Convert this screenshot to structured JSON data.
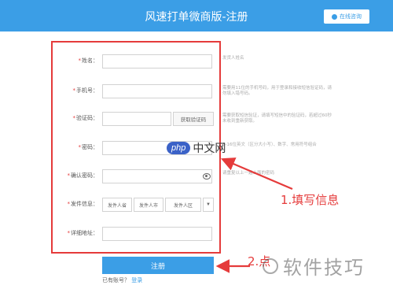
{
  "header": {
    "title": "风速打单微商版-注册",
    "consult_label": "在线咨询"
  },
  "fields": [
    {
      "label": "姓名：",
      "hint": "发货人姓名"
    },
    {
      "label": "手机号：",
      "hint": "需要用11位的手机号码，用于登录和接收短信验证码，请勿填入错号码。"
    },
    {
      "label": "验证码：",
      "hint": "需要获取短信验证，请填写短信中的验证码，若超过60秒未收到重新获取。",
      "button": "获取验证码"
    },
    {
      "label": "密码：",
      "hint": "6-16位英文（区分大小写）、数字、常用符号组合"
    },
    {
      "label": "确认密码：",
      "hint": "请重复以上一遍上面的密码"
    },
    {
      "label": "发件信息：",
      "selects": [
        "发件人省",
        "发件人市",
        "发件人区"
      ]
    },
    {
      "label": "详细地址：",
      "hint": ""
    }
  ],
  "register_label": "注册",
  "login_prompt": "已有账号？",
  "login_link": "登录",
  "annotations": {
    "step1": "1.填写信息",
    "step2": "2.点"
  },
  "watermarks": {
    "php_badge": "php",
    "php_text": "中文网",
    "skill": "软件技巧"
  },
  "colors": {
    "primary": "#3b9ee6",
    "annotation": "#e53b3b"
  }
}
